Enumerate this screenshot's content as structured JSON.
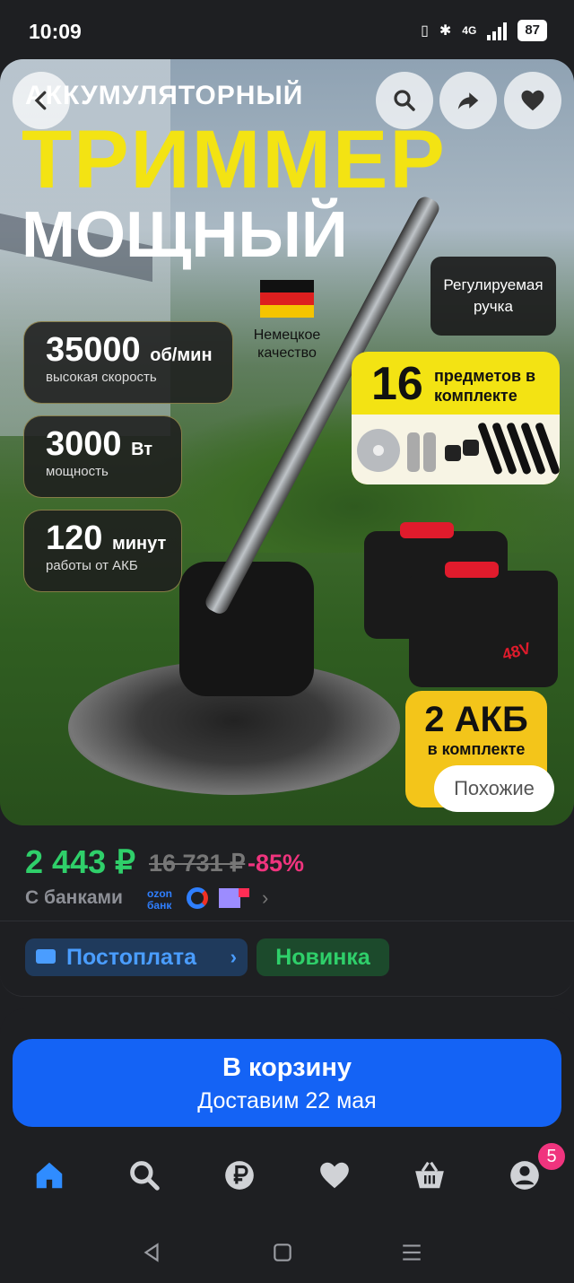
{
  "status_bar": {
    "time": "10:09",
    "network": "4G",
    "battery": "87"
  },
  "hero": {
    "headline_small": "АККУМУЛЯТОРНЫЙ",
    "headline_big": "ТРИММЕР",
    "headline_mid": "МОЩНЫЙ",
    "quality": "Немецкое качество",
    "adjustable_handle": "Регулируемая ручка",
    "kit_count": "16",
    "kit_text": "предметов в комплекте",
    "battery_count": "2 АКБ",
    "battery_text": "в комплекте",
    "battery_label": "48V",
    "similar_button": "Похожие",
    "specs": [
      {
        "value": "35000",
        "unit": "об/мин",
        "caption": "высокая скорость"
      },
      {
        "value": "3000",
        "unit": "Вт",
        "caption": "мощность"
      },
      {
        "value": "120",
        "unit": "минут",
        "caption": "работы от АКБ"
      }
    ]
  },
  "price": {
    "current": "2 443 ₽",
    "old": "16 731 ₽",
    "discount": "-85%",
    "banks_label": "С банками",
    "ozon_bank": "ozon банк"
  },
  "badges": {
    "postpay": "Постоплата",
    "new": "Новинка"
  },
  "cart": {
    "button_label": "В корзину",
    "delivery": "Доставим 22 мая"
  },
  "tabbar": {
    "cart_badge": "5",
    "icons": [
      "home-icon",
      "search-icon",
      "ruble-icon",
      "heart-icon",
      "basket-icon",
      "profile-icon"
    ]
  },
  "colors": {
    "accent_blue": "#1463f5",
    "price_green": "#2fcf6a",
    "discount_pink": "#f0347e",
    "promo_yellow": "#f3e313"
  }
}
